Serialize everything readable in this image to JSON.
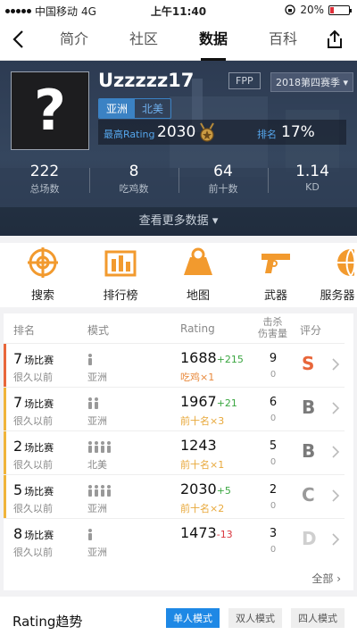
{
  "status_bar": {
    "carrier": "中国移动",
    "network": "4G",
    "time": "上午11:40",
    "battery": "20%",
    "battery_level": 0.2
  },
  "nav": {
    "tabs": [
      "简介",
      "社区",
      "数据",
      "百科"
    ],
    "active_tab": "数据"
  },
  "profile": {
    "avatar_text": "?",
    "username": "Uzzzzz17",
    "regions": [
      "亚洲",
      "北美"
    ],
    "selected_region": "亚洲",
    "perspective": "FPP",
    "season": "2018第四赛季",
    "rating_label": "最高Rating",
    "rating_value": "2030",
    "rank_label": "排名",
    "rank_value": "17%",
    "stats": [
      {
        "value": "222",
        "label": "总场数"
      },
      {
        "value": "8",
        "label": "吃鸡数"
      },
      {
        "value": "64",
        "label": "前十数"
      },
      {
        "value": "1.14",
        "label": "KD"
      }
    ],
    "more_label": "查看更多数据"
  },
  "functions": [
    {
      "label": "搜索",
      "icon": "crosshair-icon"
    },
    {
      "label": "排行榜",
      "icon": "leaderboard-icon"
    },
    {
      "label": "地图",
      "icon": "map-icon"
    },
    {
      "label": "武器",
      "icon": "pistol-icon"
    },
    {
      "label": "服务器",
      "icon": "server-icon"
    }
  ],
  "table": {
    "headers": {
      "rank": "排名",
      "mode": "模式",
      "rating": "Rating",
      "kill_line1": "击杀",
      "kill_line2": "伤害量",
      "score": "评分"
    },
    "rows": [
      {
        "count": "7",
        "unit": "场比赛",
        "ago": "很久以前",
        "team_size": 1,
        "region": "亚洲",
        "rating": "1688",
        "change": "+215",
        "tag": "吃鸡×1",
        "kills": "9",
        "damage": "0",
        "grade": "S",
        "bar_color": "#e8663a",
        "grade_color": "#e8663a",
        "change_color": "#3aa640",
        "tag_color": "#e8883a"
      },
      {
        "count": "7",
        "unit": "场比赛",
        "ago": "很久以前",
        "team_size": 2,
        "region": "亚洲",
        "rating": "1967",
        "change": "+21",
        "tag": "前十名×3",
        "kills": "6",
        "damage": "0",
        "grade": "B",
        "bar_color": "#f0b43a",
        "grade_color": "#7a7a7a",
        "change_color": "#3aa640",
        "tag_color": "#e8a83a"
      },
      {
        "count": "2",
        "unit": "场比赛",
        "ago": "很久以前",
        "team_size": 4,
        "region": "北美",
        "rating": "1243",
        "change": "",
        "tag": "前十名×1",
        "kills": "5",
        "damage": "0",
        "grade": "B",
        "bar_color": "#f0b43a",
        "grade_color": "#7a7a7a",
        "change_color": "#3aa640",
        "tag_color": "#e8a83a"
      },
      {
        "count": "5",
        "unit": "场比赛",
        "ago": "很久以前",
        "team_size": 4,
        "region": "亚洲",
        "rating": "2030",
        "change": "+5",
        "tag": "前十名×2",
        "kills": "2",
        "damage": "0",
        "grade": "C",
        "bar_color": "#f0b43a",
        "grade_color": "#9a9a9a",
        "change_color": "#3aa640",
        "tag_color": "#e8a83a"
      },
      {
        "count": "8",
        "unit": "场比赛",
        "ago": "很久以前",
        "team_size": 1,
        "region": "亚洲",
        "rating": "1473",
        "change": "-13",
        "tag": "",
        "kills": "3",
        "damage": "0",
        "grade": "D",
        "bar_color": "#ffffff",
        "grade_color": "#cfcfcf",
        "change_color": "#d9363e",
        "tag_color": "#e8a83a"
      }
    ],
    "all_label": "全部"
  },
  "trend": {
    "title": "Rating趋势",
    "modes": [
      "单人模式",
      "双人模式",
      "四人模式"
    ],
    "active_mode": "单人模式"
  }
}
